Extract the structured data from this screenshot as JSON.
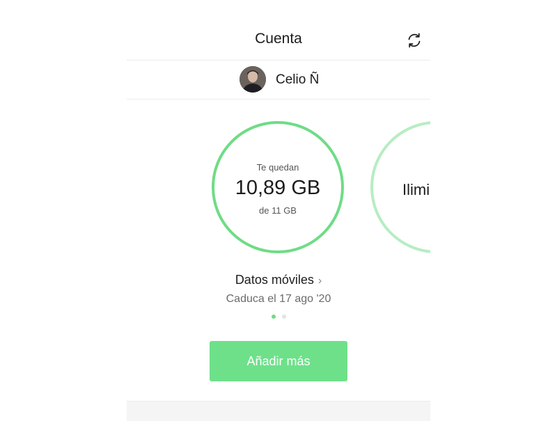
{
  "header": {
    "title": "Cuenta",
    "refresh_icon": "refresh-icon"
  },
  "user": {
    "name": "Celio Ñ"
  },
  "carousel": {
    "cards": [
      {
        "label": "Te quedan",
        "value": "10,89 GB",
        "total": "de 11 GB",
        "remaining_fraction": 0.99
      },
      {
        "label": "Ilimi"
      }
    ],
    "plan_title": "Datos móviles",
    "plan_chevron": "›",
    "expiry": "Caduca el 17 ago '20",
    "page_count": 2,
    "active_page": 0
  },
  "actions": {
    "add_more_label": "Añadir más"
  },
  "colors": {
    "accent": "#6fdc85",
    "accent_light": "#b6edc2",
    "button": "#6ee08a"
  }
}
